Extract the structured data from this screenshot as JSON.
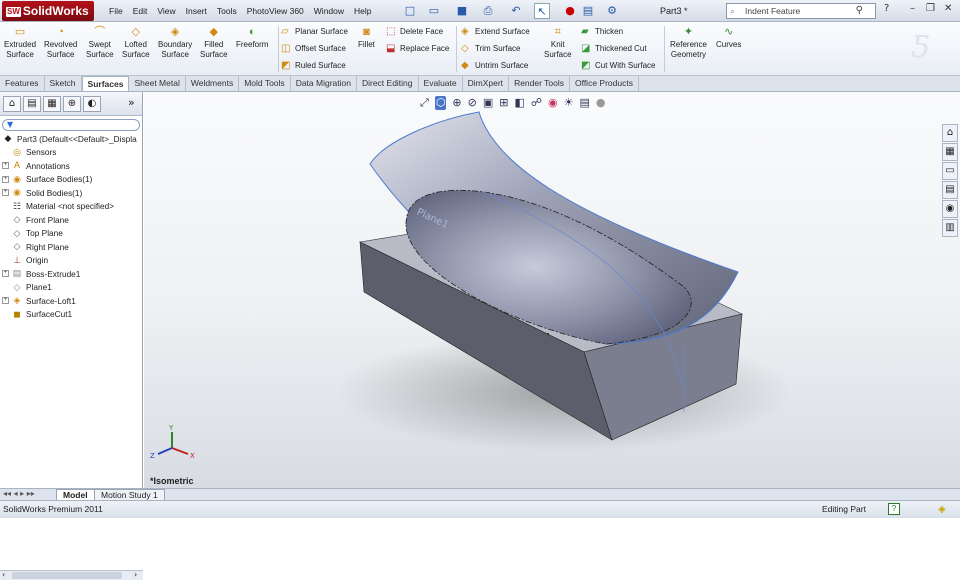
{
  "app": {
    "name": "SolidWorks",
    "logo_badge": "SW",
    "document": "Part3 *"
  },
  "menu": [
    "File",
    "Edit",
    "View",
    "Insert",
    "Tools",
    "PhotoView 360",
    "Window",
    "Help"
  ],
  "search": {
    "value": "Indent Feature"
  },
  "ribbon": {
    "big_buttons": [
      {
        "label": "Extruded\nSurface",
        "icon": "extruded-surface-icon"
      },
      {
        "label": "Revolved\nSurface",
        "icon": "revolved-surface-icon"
      },
      {
        "label": "Swept\nSurface",
        "icon": "swept-surface-icon"
      },
      {
        "label": "Lofted\nSurface",
        "icon": "lofted-surface-icon"
      },
      {
        "label": "Boundary\nSurface",
        "icon": "boundary-surface-icon"
      },
      {
        "label": "Filled\nSurface",
        "icon": "filled-surface-icon"
      },
      {
        "label": "Freeform",
        "icon": "freeform-icon"
      }
    ],
    "col1": [
      "Planar Surface",
      "Offset Surface",
      "Ruled Surface"
    ],
    "fillet": "Fillet",
    "col2": [
      "Delete Face",
      "Replace Face"
    ],
    "col3": [
      "Extend Surface",
      "Trim Surface",
      "Untrim Surface"
    ],
    "knit": "Knit\nSurface",
    "col4": [
      "Thicken",
      "Thickened Cut",
      "Cut With Surface"
    ],
    "reference_geometry": "Reference\nGeometry",
    "curves": "Curves"
  },
  "tabs": [
    "Features",
    "Sketch",
    "Surfaces",
    "Sheet Metal",
    "Weldments",
    "Mold Tools",
    "Data Migration",
    "Direct Editing",
    "Evaluate",
    "DimXpert",
    "Render Tools",
    "Office Products"
  ],
  "active_tab": "Surfaces",
  "tree": {
    "root": "Part3  (Default<<Default>_Displa",
    "items": [
      {
        "label": "Sensors",
        "exp": false
      },
      {
        "label": "Annotations",
        "exp": true
      },
      {
        "label": "Surface Bodies(1)",
        "exp": true
      },
      {
        "label": "Solid Bodies(1)",
        "exp": true
      },
      {
        "label": "Material <not specified>",
        "exp": false
      },
      {
        "label": "Front Plane",
        "exp": false
      },
      {
        "label": "Top Plane",
        "exp": false
      },
      {
        "label": "Right Plane",
        "exp": false
      },
      {
        "label": "Origin",
        "exp": false
      },
      {
        "label": "Boss-Extrude1",
        "exp": true
      },
      {
        "label": "Plane1",
        "exp": false
      },
      {
        "label": "Surface-Loft1",
        "exp": true
      },
      {
        "label": "SurfaceCut1",
        "exp": false
      }
    ]
  },
  "viewport": {
    "label": "*Isometric",
    "plane_label": "Plane1"
  },
  "bottom_tabs": [
    "Model",
    "Motion Study 1"
  ],
  "status": {
    "left": "SolidWorks Premium 2011",
    "right": "Editing Part"
  }
}
